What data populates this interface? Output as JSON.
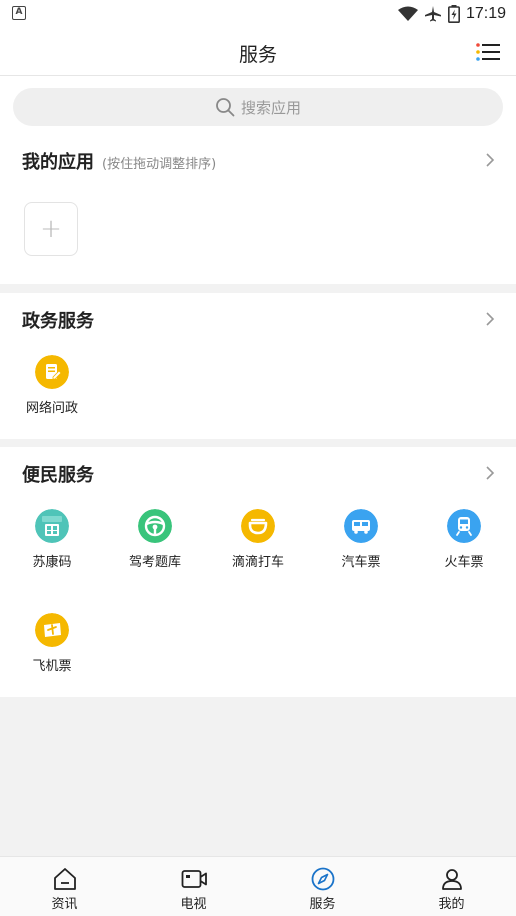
{
  "status": {
    "time": "17:19",
    "left_icon": "A"
  },
  "header": {
    "title": "服务",
    "menu_icon": "list-icon"
  },
  "search": {
    "placeholder": "搜索应用"
  },
  "my_apps": {
    "title": "我的应用",
    "hint": "(按住拖动调整排序)",
    "add_label": "+"
  },
  "gov": {
    "title": "政务服务",
    "items": [
      {
        "label": "网络问政",
        "icon": "document-icon",
        "color": "#f5b800"
      }
    ]
  },
  "life": {
    "title": "便民服务",
    "items": [
      {
        "label": "苏康码",
        "icon": "qr-health-icon",
        "color": "#4fc4b8"
      },
      {
        "label": "驾考题库",
        "icon": "steering-wheel-icon",
        "color": "#39c47b"
      },
      {
        "label": "滴滴打车",
        "icon": "didi-icon",
        "color": "#f5b800"
      },
      {
        "label": "汽车票",
        "icon": "bus-icon",
        "color": "#3aa3f0"
      },
      {
        "label": "火车票",
        "icon": "train-icon",
        "color": "#3aa3f0"
      },
      {
        "label": "飞机票",
        "icon": "ticket-icon",
        "color": "#f5b800"
      }
    ]
  },
  "tabs": [
    {
      "label": "资讯",
      "icon": "home-icon",
      "active": false
    },
    {
      "label": "电视",
      "icon": "video-icon",
      "active": false
    },
    {
      "label": "服务",
      "icon": "compass-icon",
      "active": true
    },
    {
      "label": "我的",
      "icon": "user-icon",
      "active": false
    }
  ],
  "colors": {
    "accent": "#1a73c9",
    "yellow": "#f5b800"
  }
}
